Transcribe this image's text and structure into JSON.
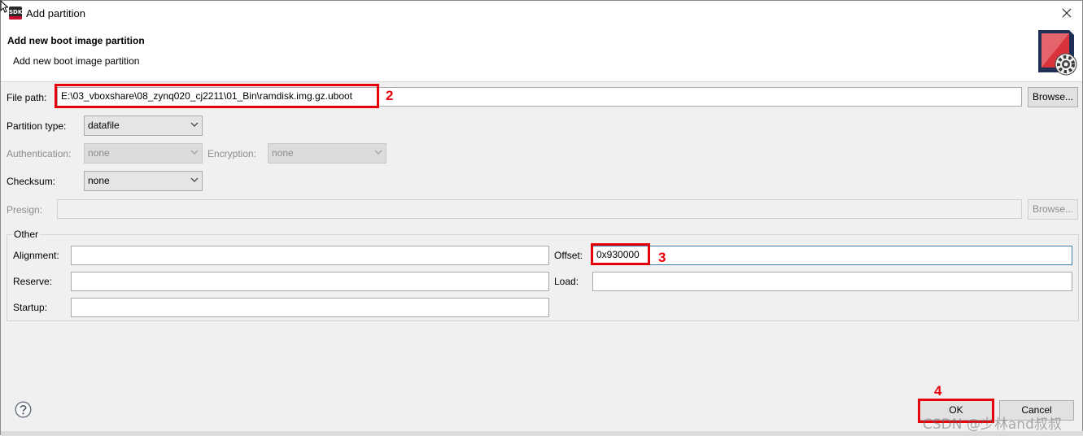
{
  "window": {
    "title": "Add partition",
    "icon_text": "SDK",
    "close_icon": "close-icon"
  },
  "header": {
    "title": "Add new boot image partition",
    "description": "Add new boot image partition",
    "logo_icon": "gear-partition-icon"
  },
  "form": {
    "file_path": {
      "label": "File path:",
      "value": "E:\\03_vboxshare\\08_zynq020_cj2211\\01_Bin\\ramdisk.img.gz.uboot",
      "browse_label": "Browse..."
    },
    "partition_type": {
      "label": "Partition type:",
      "value": "datafile"
    },
    "authentication": {
      "label": "Authentication:",
      "value": "none",
      "enabled": false
    },
    "encryption": {
      "label": "Encryption:",
      "value": "none",
      "enabled": false
    },
    "checksum": {
      "label": "Checksum:",
      "value": "none"
    },
    "presign": {
      "label": "Presign:",
      "value": "",
      "browse_label": "Browse...",
      "enabled": false
    }
  },
  "other": {
    "group_label": "Other",
    "alignment": {
      "label": "Alignment:",
      "value": ""
    },
    "offset": {
      "label": "Offset:",
      "value": "0x930000"
    },
    "reserve": {
      "label": "Reserve:",
      "value": ""
    },
    "load": {
      "label": "Load:",
      "value": ""
    },
    "startup": {
      "label": "Startup:",
      "value": ""
    }
  },
  "footer": {
    "help_icon": "help-icon",
    "ok_label": "OK",
    "cancel_label": "Cancel"
  },
  "annotations": {
    "step2": "2",
    "step3": "3",
    "step4": "4",
    "color": "#e8000b"
  },
  "watermark": "CSDN @少林and叔叔"
}
